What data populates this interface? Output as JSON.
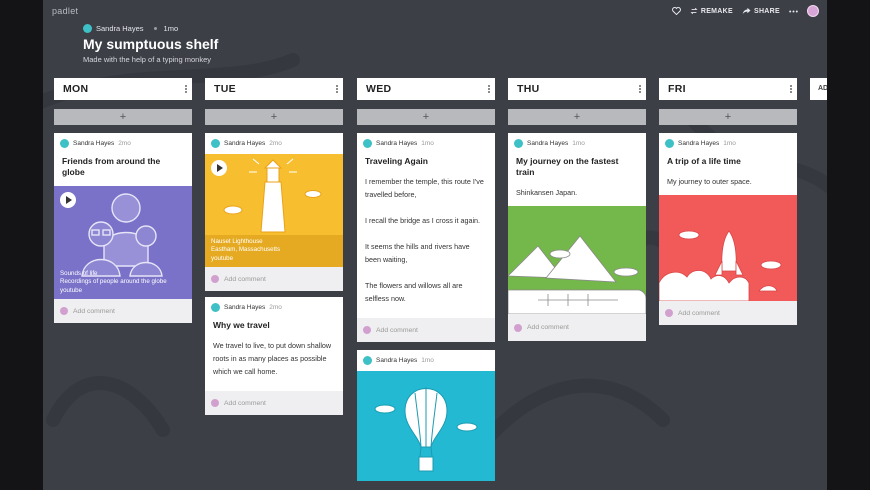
{
  "app": {
    "brand": "padlet"
  },
  "top_actions": {
    "remake": "REMAKE",
    "share": "SHARE"
  },
  "header": {
    "author": "Sandra Hayes",
    "time": "1mo",
    "title": "My sumptuous shelf",
    "subtitle": "Made with the help of a typing monkey"
  },
  "columns": [
    {
      "label": "MON",
      "cards": [
        {
          "author": "Sandra Hayes",
          "time": "2mo",
          "title": "Friends from around the globe",
          "media": {
            "caption_title": "Sounds of life",
            "caption_text": "Recordings of people around the globe",
            "caption_source": "youtube"
          },
          "comment": "Add comment"
        }
      ]
    },
    {
      "label": "TUE",
      "cards": [
        {
          "author": "Sandra Hayes",
          "time": "2mo",
          "media": {
            "caption_title": "Nauset Lighthouse",
            "caption_text": "Eastham, Massachusetts",
            "caption_source": "youtube"
          },
          "comment": "Add comment"
        },
        {
          "author": "Sandra Hayes",
          "time": "2mo",
          "title": "Why we travel",
          "body": [
            "We travel to live, to put down shallow roots in as many places as possible which we call home."
          ],
          "comment": "Add comment"
        }
      ]
    },
    {
      "label": "WED",
      "cards": [
        {
          "author": "Sandra Hayes",
          "time": "1mo",
          "title": "Traveling Again",
          "body": [
            "I remember the temple, this route I've travelled before,",
            "I recall the bridge as I cross it again.",
            "It seems the hills and rivers have been waiting,",
            "The flowers and willows all are selfless now."
          ],
          "comment": "Add comment"
        },
        {
          "author": "Sandra Hayes",
          "time": "1mo"
        }
      ]
    },
    {
      "label": "THU",
      "cards": [
        {
          "author": "Sandra Hayes",
          "time": "1mo",
          "title": "My journey on the fastest train",
          "body": [
            "Shinkansen Japan."
          ],
          "comment": "Add comment"
        }
      ]
    },
    {
      "label": "FRI",
      "cards": [
        {
          "author": "Sandra Hayes",
          "time": "1mo",
          "title": "A trip of a life time",
          "body": [
            "My journey to outer space."
          ],
          "comment": "Add comment"
        }
      ]
    }
  ],
  "peek_column": {
    "label": "AD"
  },
  "colors": {
    "stage": "#3d3f47",
    "mon_media": "#7a72c9",
    "tue_media": "#f7bf2f",
    "thu_media": "#74b74a",
    "fri_media": "#f25a5a",
    "wed_media": "#23b9d3",
    "accent": "#3ec1c6"
  }
}
